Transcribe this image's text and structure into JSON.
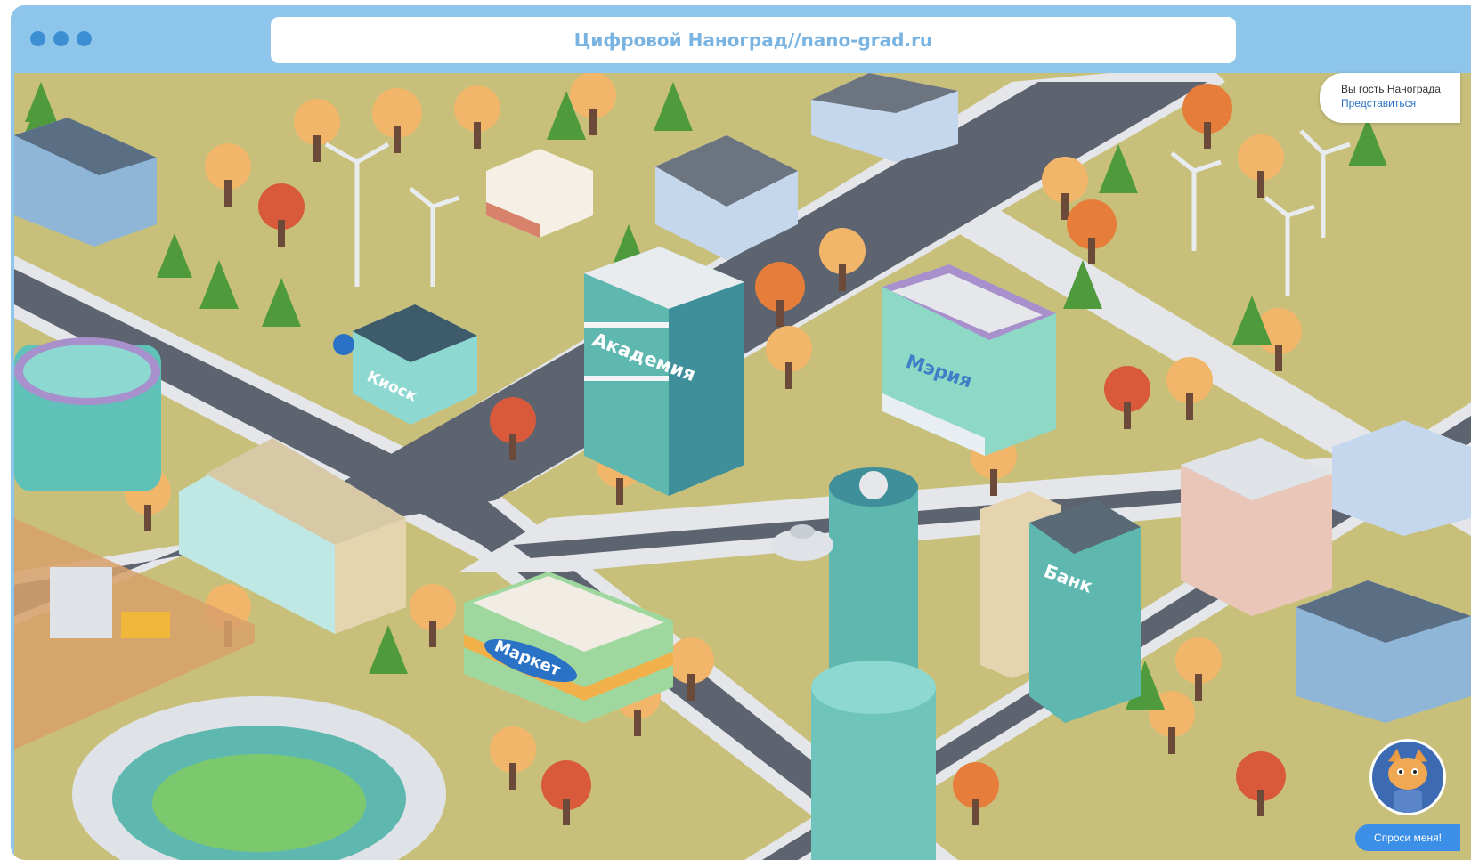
{
  "browser": {
    "window_dots": 3,
    "site_name": "Цифровой Наноград",
    "separator": "//",
    "url": "nano-grad.ru"
  },
  "map": {
    "buildings": {
      "kiosk": "Киоск",
      "academy": "Академия",
      "city_hall": "Мэрия",
      "bank": "Банк",
      "market": "Маркет"
    }
  },
  "guest_panel": {
    "status": "Вы гость Нанограда",
    "login_link": "Представиться"
  },
  "assistant": {
    "ask_button": "Спроси меня!"
  },
  "colors": {
    "frame": "#8ec5ea",
    "ground": "#c8c07a",
    "road": "#5d6470",
    "sidewalk": "#e4e6ea",
    "accent_link": "#2a72c6",
    "ask_button": "#3b8fe6"
  }
}
